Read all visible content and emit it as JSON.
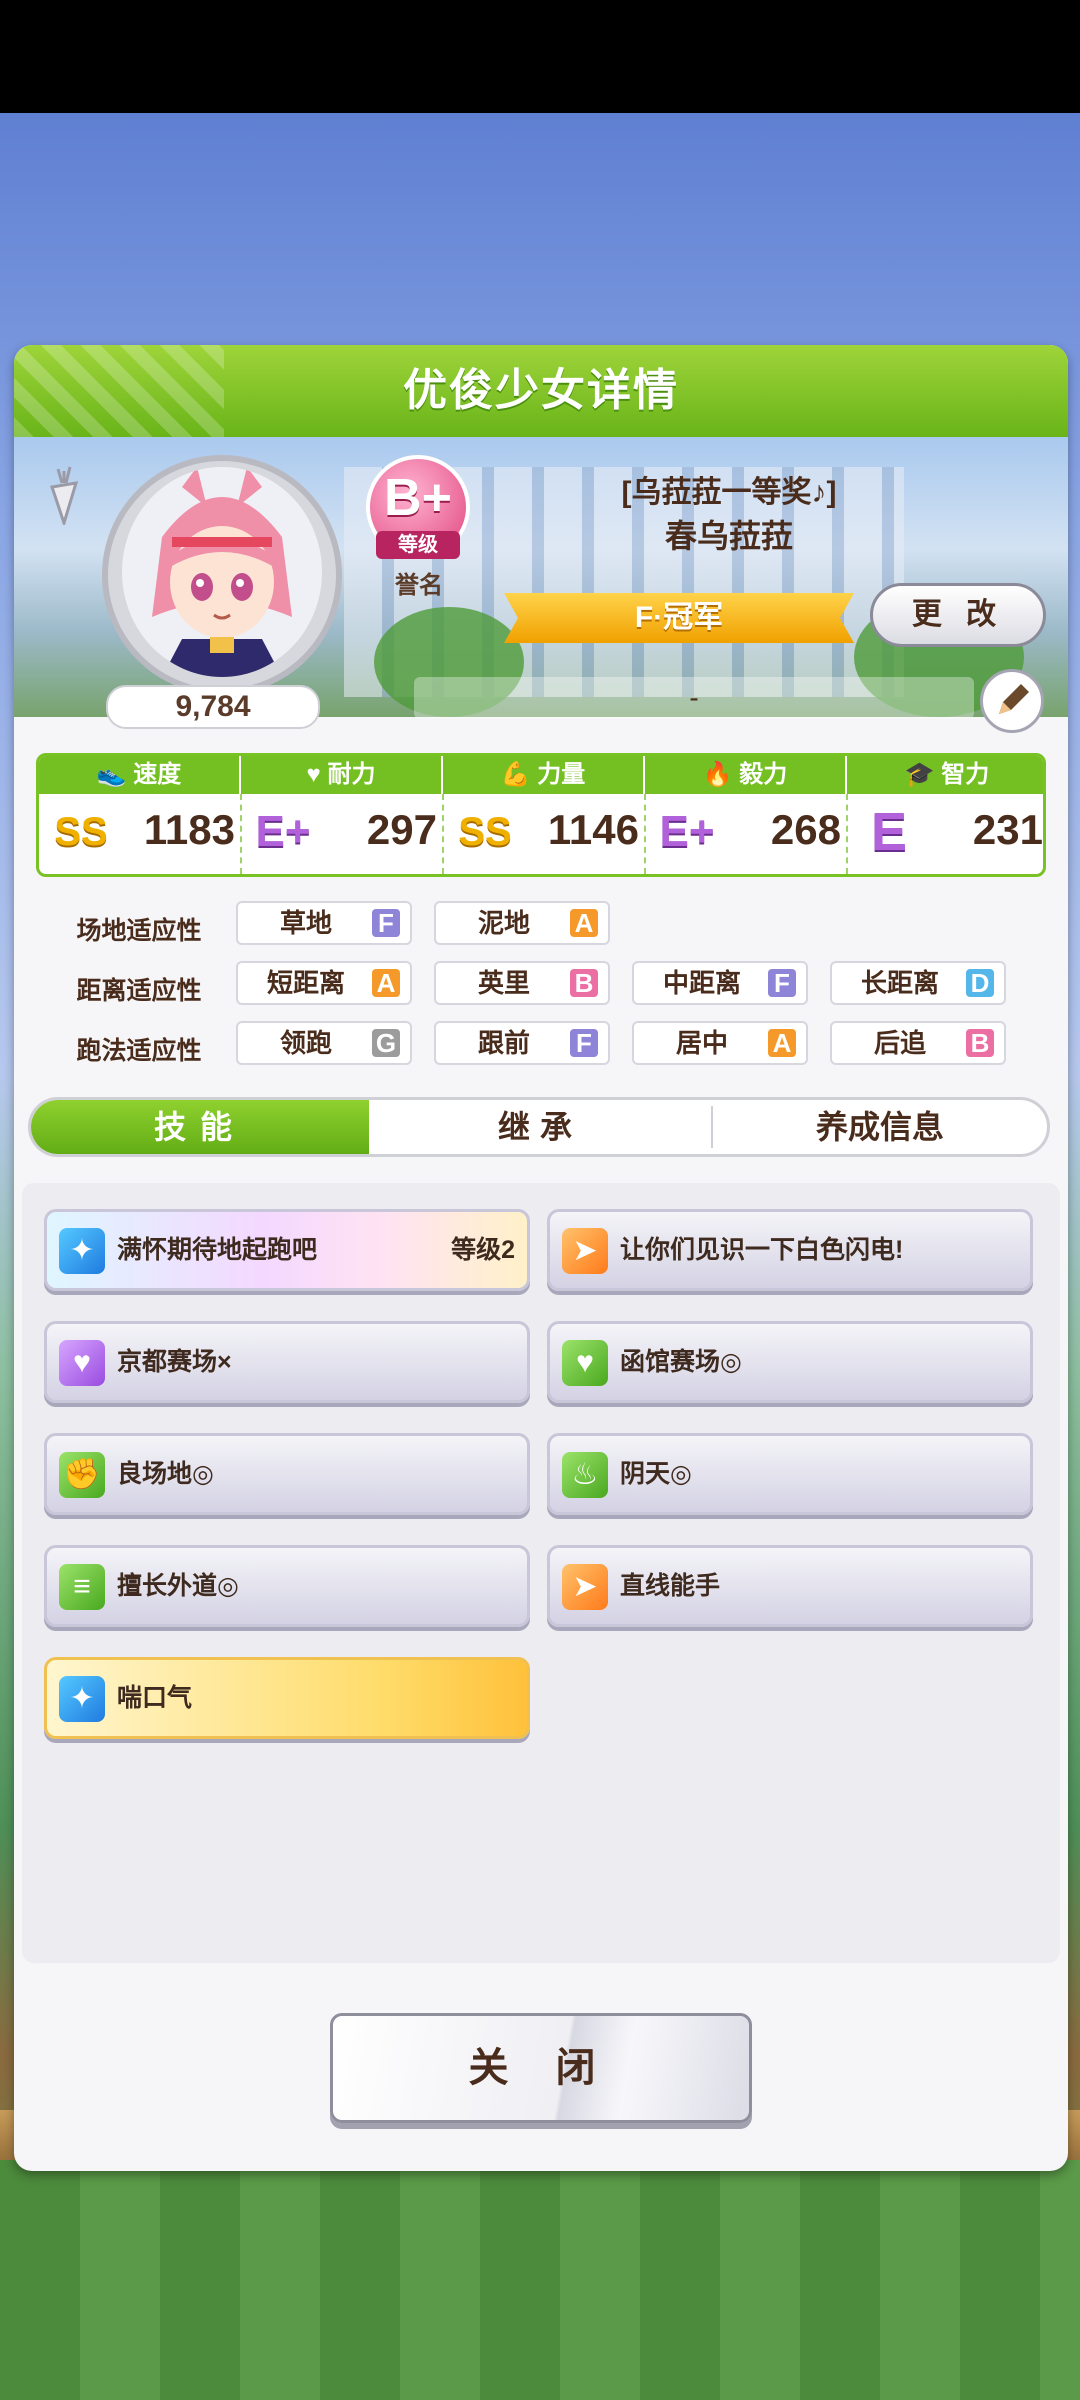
{
  "dialog": {
    "title": "优俊少女详情",
    "fans": "9,784",
    "grade": "B+",
    "grade_label": "等级",
    "reputation_label": "誉名",
    "epithet": "[乌菈菈一等奖♪]",
    "name": "春乌菈菈",
    "rank": "F·冠军",
    "change_label": "更 改",
    "comment": "-"
  },
  "stats": [
    {
      "label": "速度",
      "grade": "SS",
      "value": "1183",
      "icon": "shoe-icon"
    },
    {
      "label": "耐力",
      "grade": "E+",
      "value": "297",
      "icon": "heart-icon"
    },
    {
      "label": "力量",
      "grade": "SS",
      "value": "1146",
      "icon": "muscle-icon"
    },
    {
      "label": "毅力",
      "grade": "E+",
      "value": "268",
      "icon": "flame-icon"
    },
    {
      "label": "智力",
      "grade": "E",
      "value": "231",
      "icon": "graduation-cap-icon"
    }
  ],
  "aptitudes": {
    "field": {
      "label": "场地适应性",
      "items": [
        {
          "name": "草地",
          "grade": "F"
        },
        {
          "name": "泥地",
          "grade": "A"
        }
      ]
    },
    "distance": {
      "label": "距离适应性",
      "items": [
        {
          "name": "短距离",
          "grade": "A"
        },
        {
          "name": "英里",
          "grade": "B"
        },
        {
          "name": "中距离",
          "grade": "F"
        },
        {
          "name": "长距离",
          "grade": "D"
        }
      ]
    },
    "style": {
      "label": "跑法适应性",
      "items": [
        {
          "name": "领跑",
          "grade": "G"
        },
        {
          "name": "跟前",
          "grade": "F"
        },
        {
          "name": "居中",
          "grade": "A"
        },
        {
          "name": "后追",
          "grade": "B"
        }
      ]
    }
  },
  "tabs": [
    "技能",
    "继承",
    "养成信息"
  ],
  "skills": [
    {
      "name": "满怀期待地起跑吧",
      "level": "等级2",
      "icon": "sparkle-icon",
      "style": "rainbow"
    },
    {
      "name": "让你们见识一下白色闪电!",
      "level": "",
      "icon": "run-icon",
      "style": "normal"
    },
    {
      "name": "京都赛场×",
      "level": "",
      "icon": "heart-icon",
      "style": "normal"
    },
    {
      "name": "函馆赛场◎",
      "level": "",
      "icon": "heart-icon",
      "style": "normal"
    },
    {
      "name": "良场地◎",
      "level": "",
      "icon": "muscle-icon",
      "style": "normal"
    },
    {
      "name": "阴天◎",
      "level": "",
      "icon": "flame-icon",
      "style": "normal"
    },
    {
      "name": "擅长外道◎",
      "level": "",
      "icon": "stairs-icon",
      "style": "normal"
    },
    {
      "name": "直线能手",
      "level": "",
      "icon": "run-icon",
      "style": "normal"
    },
    {
      "name": "喘口气",
      "level": "",
      "icon": "sparkle-icon",
      "style": "gold"
    }
  ],
  "close_label": "关 闭"
}
